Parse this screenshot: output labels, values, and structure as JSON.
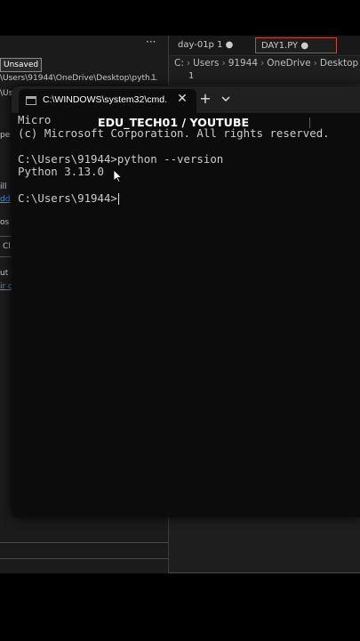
{
  "background_editor": {
    "tabs": [
      "day-01p 1 ●",
      "DAY1.PY ●"
    ],
    "breadcrumb": [
      "C:",
      "Users",
      "91944",
      "OneDrive",
      "Desktop",
      "›"
    ],
    "line_number": "1",
    "unsaved_badge": "Unsaved",
    "file_path": "\\Users\\91944\\OneDrive\\Desktop\\pyth...",
    "path_count": "1",
    "overflow_glyph": "···",
    "fragments": {
      "us": "\\Us",
      "per": "pe",
      "ill": "ill",
      "dd": "dd",
      "os": "os",
      "cl": "Cl",
      "ut": "ut h",
      "ir": "ir c"
    }
  },
  "terminal": {
    "tab_title": "C:\\WINDOWS\\system32\\cmd.",
    "tab_close_glyph": "✕",
    "new_tab_glyph": "+",
    "lines": [
      "Micro",
      "(c) Microsoft Corporation. All rights reserved.",
      "",
      "C:\\Users\\91944>python --version",
      "Python 3.13.0",
      "",
      "C:\\Users\\91944>"
    ]
  },
  "watermark": "EDU_TECH01 / YOUTUBE",
  "colors": {
    "terminal_bg": "#0c0c0c",
    "tab_bar_bg": "#202020",
    "terminal_text": "#cccccc",
    "active_editor_tab_border": "#c24a3c",
    "link_blue": "#3794ff"
  },
  "icons": {
    "terminal_tab_icon": "cmd-window-icon",
    "close": "close-icon",
    "new_tab": "plus-icon",
    "dropdown": "chevron-down-icon",
    "mouse": "mouse-pointer-icon"
  }
}
